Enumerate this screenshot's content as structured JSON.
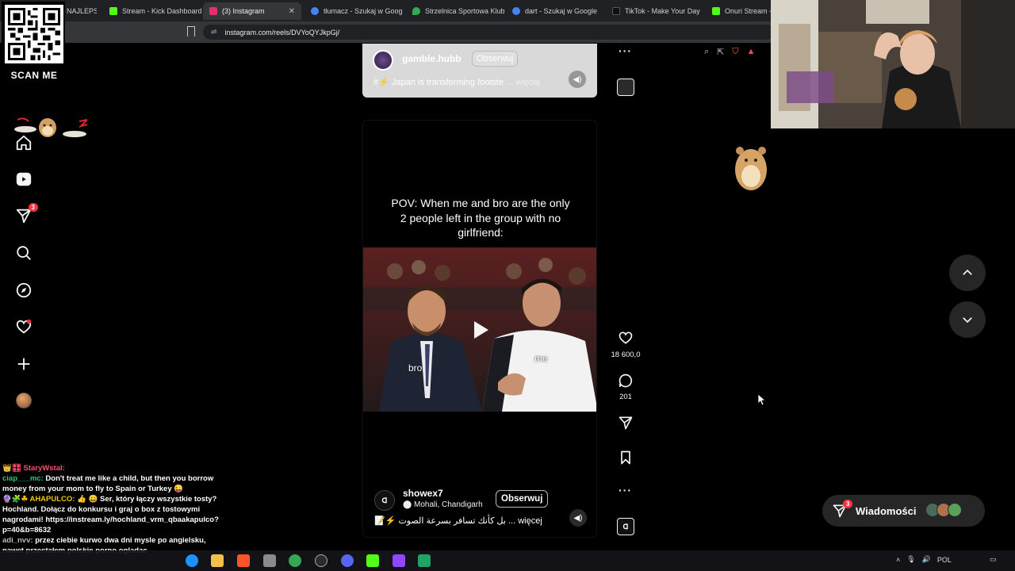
{
  "browser": {
    "tabs": [
      {
        "label": "NAJLEPSZ",
        "color": "#3b3b3b"
      },
      {
        "label": "Stream - Kick Dashboard",
        "color": "#53fc18"
      },
      {
        "label": "(3) Instagram",
        "color": "#e1306c",
        "active": true
      },
      {
        "label": "tłumacz - Szukaj w Google",
        "color": "#4285f4"
      },
      {
        "label": "Strzelnica Sportowa Klub S",
        "color": "#34a853"
      },
      {
        "label": "dart - Szukaj w Google",
        "color": "#4285f4"
      },
      {
        "label": "TikTok - Make Your Day",
        "color": "#111111"
      },
      {
        "label": "Onuri Stream - W",
        "color": "#53fc18"
      }
    ],
    "url": "instagram.com/reels/DVYoQYJkpGj/"
  },
  "overlay": {
    "qr_label": "SCAN ME"
  },
  "nav": {
    "notifications_badge": "3"
  },
  "reel_prev": {
    "username": "gamble.hubb",
    "follow_label": "Obserwuj",
    "caption": "#⚡ Japan is transforming footste",
    "more": "... więcej"
  },
  "reel": {
    "title": "POV: When me and bro are the only 2 people left in the group with no girlfriend:",
    "label_left": "bro",
    "label_right": "me",
    "username": "showex7",
    "location": "Mohali, Chandigarh",
    "follow_label": "Obserwuj",
    "caption": "📝⚡ بل كأنك تسافر بسرعة الصوت",
    "more": "... więcej",
    "likes": "18 600,0",
    "comments": "201"
  },
  "messages": {
    "label": "Wiadomości",
    "badge": "3"
  },
  "chat": [
    {
      "name": "👑🎛 StaryWstal:",
      "text": "",
      "color": "#ff4d6d"
    },
    {
      "name": "ciap___mc:",
      "text": "Don't treat me like a child, but then you borrow money from your mom to fly to Spain or Turkey 😜",
      "color": "#2ecc71"
    },
    {
      "name": "🔮🧩☘ AHAPULCO:",
      "text": "👍 😀 Ser, który łączy wszystkie tosty? Hochland. Dołącz do konkursu i graj o box z tostowymi nagrodami! https://instream.ly/hochland_vrm_qbaakapulco?p=40&b=8632",
      "color": "#f1c40f"
    },
    {
      "name": "adi_nvv:",
      "text": "przez ciebie kurwo dwa dni mysle po angielsku, nawet przestałem polskie porno ogladac",
      "color": "#bbbbbb"
    }
  ],
  "taskbar": {
    "lang": "POL"
  }
}
